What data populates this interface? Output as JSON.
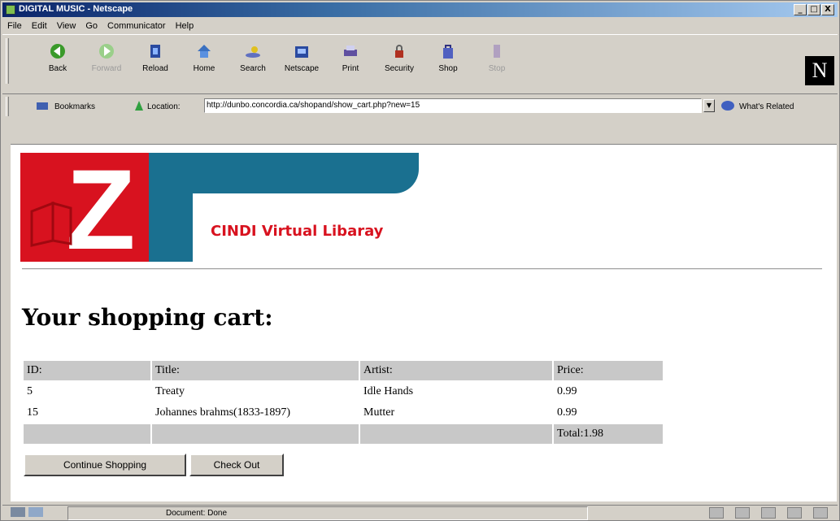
{
  "window": {
    "title": "DIGITAL MUSIC - Netscape",
    "minimize": "_",
    "maximize": "□",
    "close": "X"
  },
  "menu": [
    "File",
    "Edit",
    "View",
    "Go",
    "Communicator",
    "Help"
  ],
  "toolbar": [
    {
      "label": "Back",
      "icon": "back-arrow-icon",
      "enabled": true
    },
    {
      "label": "Forward",
      "icon": "forward-arrow-icon",
      "enabled": false
    },
    {
      "label": "Reload",
      "icon": "reload-icon",
      "enabled": true
    },
    {
      "label": "Home",
      "icon": "home-icon",
      "enabled": true
    },
    {
      "label": "Search",
      "icon": "search-icon",
      "enabled": true
    },
    {
      "label": "Netscape",
      "icon": "netscape-icon",
      "enabled": true
    },
    {
      "label": "Print",
      "icon": "print-icon",
      "enabled": true
    },
    {
      "label": "Security",
      "icon": "security-lock-icon",
      "enabled": true
    },
    {
      "label": "Shop",
      "icon": "shop-bag-icon",
      "enabled": true
    },
    {
      "label": "Stop",
      "icon": "stop-icon",
      "enabled": false
    }
  ],
  "throbber": "N",
  "location_bar": {
    "bookmarks_label": "Bookmarks",
    "location_label": "Location:",
    "url": "http://dunbo.concordia.ca/shopand/show_cart.php?new=15",
    "related_label": "What's Related"
  },
  "banner": {
    "name": "CINDI Virtual Libaray",
    "logo_letter": "Z"
  },
  "page": {
    "heading": "Your shopping cart:",
    "table": {
      "headers": [
        "ID:",
        "Title:",
        "Artist:",
        "Price:"
      ],
      "rows": [
        [
          "5",
          "Treaty",
          "Idle Hands",
          "0.99"
        ],
        [
          "15",
          "Johannes brahms(1833-1897)",
          "Mutter",
          "0.99"
        ]
      ],
      "total": "Total:1.98"
    },
    "buttons": {
      "continue": "Continue Shopping",
      "checkout": "Check Out"
    }
  },
  "status": {
    "text": "Document: Done"
  },
  "colors": {
    "banner_red": "#d8121f",
    "banner_blue": "#1a7090",
    "table_header": "#c8c8c8"
  }
}
